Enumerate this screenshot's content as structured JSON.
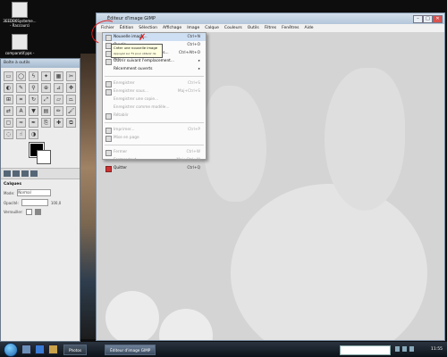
{
  "desktop": {
    "icons": [
      {
        "label_line1": "3EEDB6Systeme...",
        "label_line2": "- Raccourci"
      },
      {
        "label_line1": "comparatif.pps -",
        "label_line2": ""
      }
    ]
  },
  "toolbox": {
    "title": "Boîte à outils",
    "layers_title": "Calques",
    "mode_label": "Mode:",
    "mode_value": "Normal",
    "opacity_label": "Opacité:",
    "opacity_value": "100,0",
    "lock_label": "Verrouiller:"
  },
  "gimp_window": {
    "title": "Éditeur d'image GIMP",
    "menubar": [
      "Fichier",
      "Édition",
      "Sélection",
      "Affichage",
      "Image",
      "Calque",
      "Couleurs",
      "Outils",
      "Filtres",
      "Fenêtres",
      "Aide"
    ]
  },
  "file_menu": {
    "items": [
      {
        "label": "Nouvelle image...",
        "shortcut": "Ctrl+N"
      },
      {
        "label": "Ouvrir...",
        "shortcut": "Ctrl+O"
      },
      {
        "label": "Ouvrir en tant que calques...",
        "shortcut": "Ctrl+Alt+O"
      },
      {
        "label": "Ouvrir suivant l'emplacement...",
        "shortcut": ""
      },
      {
        "label": "Récemment ouverts",
        "shortcut": ""
      },
      {
        "label": "Enregistrer",
        "shortcut": "Ctrl+S"
      },
      {
        "label": "Enregistrer sous...",
        "shortcut": "Maj+Ctrl+S"
      },
      {
        "label": "Enregistrer une copie...",
        "shortcut": ""
      },
      {
        "label": "Enregistrer comme modèle...",
        "shortcut": ""
      },
      {
        "label": "Rétablir",
        "shortcut": ""
      },
      {
        "label": "Imprimer...",
        "shortcut": "Ctrl+P"
      },
      {
        "label": "Mise en page",
        "shortcut": ""
      },
      {
        "label": "Fermer",
        "shortcut": "Ctrl+W"
      },
      {
        "label": "Fermer tout",
        "shortcut": "Maj+Ctrl+W"
      },
      {
        "label": "Quitter",
        "shortcut": "Ctrl+Q"
      }
    ]
  },
  "tooltip": {
    "text": "Créer une nouvelle image",
    "hint": "Appuyez sur F1 pour obtenir de l'aide"
  },
  "taskbar": {
    "tasks": [
      "Photos",
      "Éditeur d'image GIMP"
    ],
    "clock": "11:55"
  },
  "colors": {
    "accent_annotation": "#e02020",
    "menu_highlight": "#cfdff3"
  }
}
